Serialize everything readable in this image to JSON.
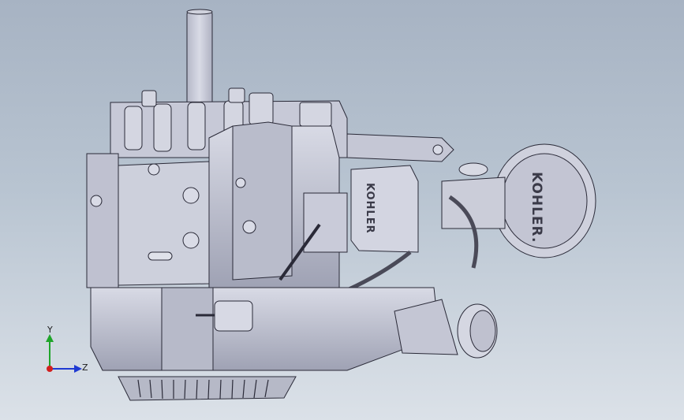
{
  "viewport": {
    "background_top": "#a7b3c3",
    "background_bottom": "#dbe1e8",
    "model_fill": "#c9cbd9",
    "model_shadow": "#a3a6b8",
    "model_edge": "#2a2a38"
  },
  "model": {
    "brand_text": "KOHLER",
    "brand_text_filter": "KOHLER."
  },
  "triad": {
    "x_axis": {
      "label": "",
      "color": "#d21f1f"
    },
    "y_axis": {
      "label": "Y",
      "color": "#1fa52a"
    },
    "z_axis": {
      "label": "Z",
      "color": "#1f3ad2"
    }
  }
}
